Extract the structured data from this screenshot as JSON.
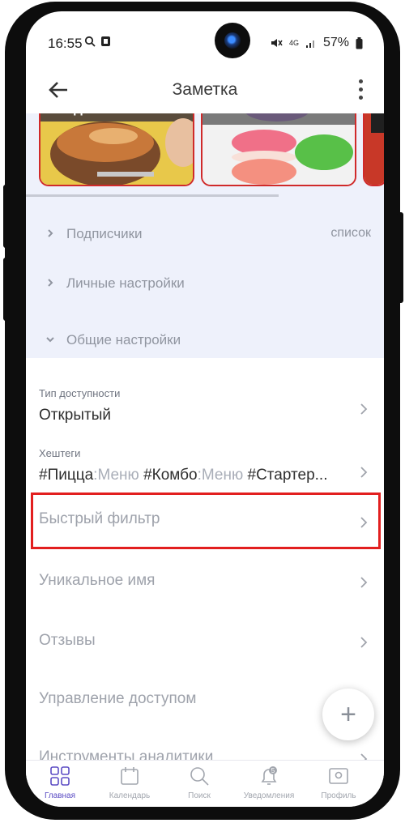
{
  "status_bar": {
    "time": "16:55",
    "network": "4G",
    "battery": "57%"
  },
  "app_bar": {
    "title": "Заметка"
  },
  "cards": [
    {
      "label": "сендвичи"
    },
    {
      "label": ""
    }
  ],
  "sections": [
    {
      "label": "Подписчики",
      "right": "список"
    },
    {
      "label": "Личные настройки",
      "right": ""
    },
    {
      "label": "Общие настройки",
      "right": ""
    }
  ],
  "settings": {
    "access": {
      "caption": "Тип доступности",
      "value": "Открытый"
    },
    "hashtags": {
      "caption": "Хештеги",
      "tags": [
        {
          "tag": "#Пицца",
          "category": ":Меню"
        },
        {
          "tag": "#Комбо",
          "category": ":Меню"
        },
        {
          "tag": "#Стартер...",
          "category": ""
        }
      ]
    },
    "quick_filter": "Быстрый фильтр",
    "unique_name": "Уникальное имя",
    "reviews": "Отзывы",
    "access_management": "Управление доступом",
    "analytics_tools": "Инструменты аналитики"
  },
  "fab": {
    "label": "+"
  },
  "bottom_nav": [
    {
      "label": "Главная",
      "active": true
    },
    {
      "label": "Календарь",
      "active": false
    },
    {
      "label": "Поиск",
      "active": false
    },
    {
      "label": "Уведомления",
      "active": false,
      "badge": "5"
    },
    {
      "label": "Профиль",
      "active": false
    }
  ],
  "colors": {
    "accent": "#5b4cc4",
    "highlight": "#e21f1f",
    "panel_bg": "#eef1fb"
  }
}
